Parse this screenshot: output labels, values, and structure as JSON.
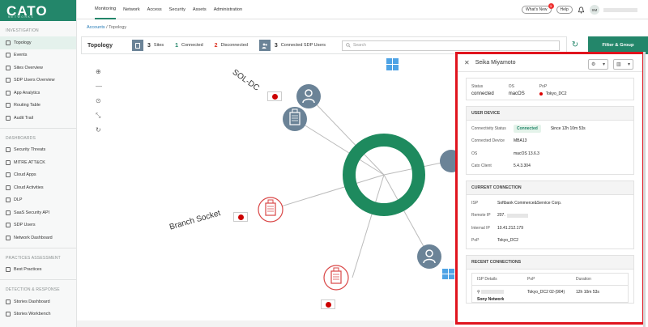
{
  "brand": {
    "name": "CATO",
    "sub": "NETWORKS"
  },
  "sidebar": {
    "sections": [
      {
        "title": "INVESTIGATION",
        "items": [
          {
            "label": "Topology",
            "active": true
          },
          {
            "label": "Events"
          },
          {
            "label": "Sites Overview"
          },
          {
            "label": "SDP Users Overview"
          },
          {
            "label": "App Analytics"
          },
          {
            "label": "Routing Table"
          },
          {
            "label": "Audit Trail"
          }
        ]
      },
      {
        "title": "DASHBOARDS",
        "items": [
          {
            "label": "Security Threats"
          },
          {
            "label": "MITRE ATT&CK"
          },
          {
            "label": "Cloud Apps"
          },
          {
            "label": "Cloud Activities"
          },
          {
            "label": "DLP"
          },
          {
            "label": "SaaS Security API"
          },
          {
            "label": "SDP Users"
          },
          {
            "label": "Network Dashboard"
          }
        ]
      },
      {
        "title": "PRACTICES ASSESSMENT",
        "items": [
          {
            "label": "Best Practices"
          }
        ]
      },
      {
        "title": "DETECTION & RESPONSE",
        "items": [
          {
            "label": "Stories Dashboard"
          },
          {
            "label": "Stories Workbench"
          }
        ]
      }
    ]
  },
  "topnav": {
    "tabs": [
      "Monitoring",
      "Network",
      "Access",
      "Security",
      "Assets",
      "Administration"
    ],
    "active": "Monitoring",
    "whats_new": "What's New",
    "whats_new_count": "3",
    "help": "Help",
    "user_initials": "SM"
  },
  "breadcrumb": {
    "root": "Accounts",
    "sep": "/",
    "current": "Topology"
  },
  "toolbar": {
    "title": "Topology",
    "sites_count": "3",
    "sites_label": "Sites",
    "connected_count": "1",
    "connected_label": "Connected",
    "disconnected_count": "2",
    "disconnected_label": "Disconnected",
    "sdp_count": "3",
    "sdp_label": "Connected SDP Users",
    "search_placeholder": "Search",
    "filter_label": "Filter & Group"
  },
  "map": {
    "sol_dc_label": "SOL-DC",
    "branch_label": "Branch Socket"
  },
  "panel": {
    "user_name": "Seika Miyamoto",
    "status": {
      "status_label": "Status",
      "status_value": "connected",
      "os_label": "OS",
      "os_value": "macOS",
      "pop_label": "PoP",
      "pop_value": "Tokyo_DC2"
    },
    "device": {
      "title": "USER DEVICE",
      "rows": [
        {
          "key": "Connectivity Status",
          "badge": "Connected",
          "extra": "Since 12h 10m 53s"
        },
        {
          "key": "Connected Device",
          "value": "MBA13"
        },
        {
          "key": "OS",
          "value": "macOS 13.6.3"
        },
        {
          "key": "Cato Client",
          "value": "5.4.3.304"
        }
      ]
    },
    "connection": {
      "title": "CURRENT CONNECTION",
      "rows": [
        {
          "key": "ISP",
          "value": "Softbank Commerce&Service Corp."
        },
        {
          "key": "Remote IP",
          "value": "207."
        },
        {
          "key": "Internal IP",
          "value": "10.41.212.179"
        },
        {
          "key": "PoP",
          "value": "Tokyo_DC2"
        }
      ]
    },
    "recent": {
      "title": "RECENT CONNECTIONS",
      "headers": [
        "ISP Details",
        "PoP",
        "Duration"
      ],
      "row": {
        "isp": "Sony Network",
        "pop": "Tokyo_DC2 02-(904)",
        "duration": "12h 10m 53s"
      }
    }
  },
  "colors": {
    "brand": "#23866a",
    "highlight": "#e0141e",
    "node": "#6b8397",
    "disconnected": "#d94646",
    "ring": "#1e8a5e"
  }
}
